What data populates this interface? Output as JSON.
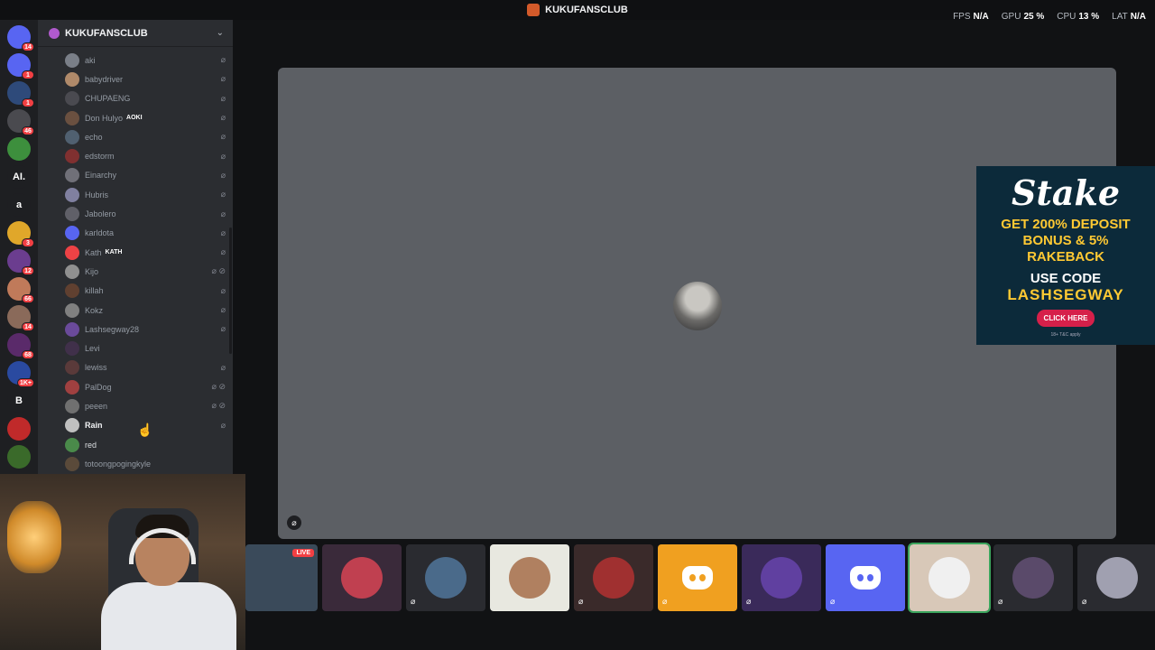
{
  "window": {
    "title": "KUKUFANSCLUB",
    "perf": [
      {
        "label": "FPS",
        "value": "N/A"
      },
      {
        "label": "GPU",
        "value": "25 %"
      },
      {
        "label": "CPU",
        "value": "13 %"
      },
      {
        "label": "LAT",
        "value": "N/A"
      }
    ]
  },
  "rail": {
    "servers": [
      {
        "name": "direct-messages",
        "glyph": "",
        "badge": "14",
        "color": "#5865f2"
      },
      {
        "name": "server-1",
        "glyph": "",
        "badge": "1",
        "color": "#5865f2"
      },
      {
        "name": "server-2",
        "glyph": "",
        "badge": "1",
        "color": "#2e4a7a"
      },
      {
        "name": "server-3",
        "glyph": "",
        "badge": "46",
        "color": "#4a4a4f"
      },
      {
        "name": "server-4",
        "glyph": "",
        "badge": "",
        "color": "#3d8f3d"
      },
      {
        "name": "server-ai",
        "glyph": "AI.",
        "badge": "",
        "color": "#1e1f22"
      },
      {
        "name": "server-a",
        "glyph": "a",
        "badge": "",
        "color": "#1e1f22"
      },
      {
        "name": "server-pikachu",
        "glyph": "",
        "badge": "3",
        "color": "#e0a72a"
      },
      {
        "name": "server-inday",
        "glyph": "",
        "badge": "12",
        "color": "#6b3d8f"
      },
      {
        "name": "server-5",
        "glyph": "",
        "badge": "66",
        "color": "#c07a5a"
      },
      {
        "name": "server-6",
        "glyph": "",
        "badge": "14",
        "color": "#8a6a5a"
      },
      {
        "name": "server-7",
        "glyph": "",
        "badge": "68",
        "color": "#5a2a6a"
      },
      {
        "name": "server-tei",
        "glyph": "",
        "badge": "1K+",
        "color": "#2a4aa0"
      },
      {
        "name": "server-b",
        "glyph": "B",
        "badge": "",
        "color": "#1e1f22"
      },
      {
        "name": "server-tei-2",
        "glyph": "",
        "badge": "",
        "color": "#c02a2a"
      },
      {
        "name": "server-8",
        "glyph": "",
        "badge": "",
        "color": "#3a6a2a"
      }
    ]
  },
  "sidebar": {
    "server_name": "KUKUFANSCLUB",
    "members": [
      {
        "name": "aki",
        "tag": "",
        "icons": "⌀",
        "color": "#7a7f88"
      },
      {
        "name": "babydriver",
        "tag": "",
        "icons": "⌀",
        "color": "#b08a6a"
      },
      {
        "name": "CHUPAENG",
        "tag": "",
        "icons": "⌀",
        "color": "#4a4a50"
      },
      {
        "name": "Don Hulyo",
        "tag": "AOKI",
        "icons": "⌀",
        "color": "#6a5040"
      },
      {
        "name": "echo",
        "tag": "",
        "icons": "⌀",
        "color": "#506070"
      },
      {
        "name": "edstorm",
        "tag": "",
        "icons": "⌀",
        "color": "#803030"
      },
      {
        "name": "Einarchy",
        "tag": "",
        "icons": "⌀",
        "color": "#707078"
      },
      {
        "name": "Hubris",
        "tag": "",
        "icons": "⌀",
        "color": "#8080a0"
      },
      {
        "name": "Jabolero",
        "tag": "",
        "icons": "⌀",
        "color": "#606068"
      },
      {
        "name": "karldota",
        "tag": "",
        "icons": "⌀",
        "color": "#5865f2"
      },
      {
        "name": "Kath",
        "tag": "KATH",
        "icons": "⌀",
        "color": "#ed4245"
      },
      {
        "name": "Kijo",
        "tag": "",
        "icons": "⌀ ⊘",
        "color": "#909090"
      },
      {
        "name": "killah",
        "tag": "",
        "icons": "⌀",
        "color": "#604030"
      },
      {
        "name": "Kokz",
        "tag": "",
        "icons": "⌀",
        "color": "#808080"
      },
      {
        "name": "Lashsegway28",
        "tag": "",
        "icons": "⌀",
        "color": "#6a4a9a"
      },
      {
        "name": "Levi",
        "tag": "",
        "icons": "",
        "color": "#40304a"
      },
      {
        "name": "lewiss",
        "tag": "",
        "icons": "⌀",
        "color": "#5a3a3a"
      },
      {
        "name": "PalDog",
        "tag": "",
        "icons": "⌀ ⊘",
        "color": "#a04040"
      },
      {
        "name": "peeen",
        "tag": "",
        "icons": "⌀ ⊘",
        "color": "#707070"
      },
      {
        "name": "Rain",
        "tag": "",
        "icons": "⌀",
        "color": "#c0c0c0"
      },
      {
        "name": "red",
        "tag": "",
        "icons": "",
        "color": "#4a8a4a"
      },
      {
        "name": "totoongpogingkyle",
        "tag": "",
        "icons": "",
        "color": "#5a4a3a"
      }
    ]
  },
  "ad": {
    "logo": "Stake",
    "bonus_line1": "GET 200% DEPOSIT",
    "bonus_line2": "BONUS & 5%",
    "bonus_line3": "RAKEBACK",
    "code_label": "USE CODE",
    "code": "LASHSEGWAY",
    "cta": "CLICK HERE",
    "fine": "18+ T&C apply"
  },
  "tiles": [
    {
      "kind": "stream",
      "live": "LIVE",
      "color": "#3a4a5a",
      "muted": false
    },
    {
      "kind": "avatar",
      "color": "#3a2a3a",
      "av": "#c04050",
      "muted": false
    },
    {
      "kind": "avatar",
      "color": "#2a2b30",
      "av": "#4a6a8a",
      "muted": true
    },
    {
      "kind": "avatar",
      "color": "#e8e8e0",
      "av": "#b08060",
      "muted": false
    },
    {
      "kind": "avatar",
      "color": "#3a2a2a",
      "av": "#a03030",
      "muted": true
    },
    {
      "kind": "discord",
      "color": "#f0a020",
      "muted": true
    },
    {
      "kind": "avatar",
      "color": "#3a2a5a",
      "av": "#6040a0",
      "muted": true
    },
    {
      "kind": "discord",
      "color": "#5865f2",
      "muted": true
    },
    {
      "kind": "avatar",
      "color": "#d8c8b8",
      "av": "#f0f0f0",
      "muted": false,
      "selected": true
    },
    {
      "kind": "avatar",
      "color": "#2a2b30",
      "av": "#5a4a6a",
      "muted": true
    },
    {
      "kind": "avatar",
      "color": "#2a2b30",
      "av": "#a0a0b0",
      "muted": true
    }
  ]
}
